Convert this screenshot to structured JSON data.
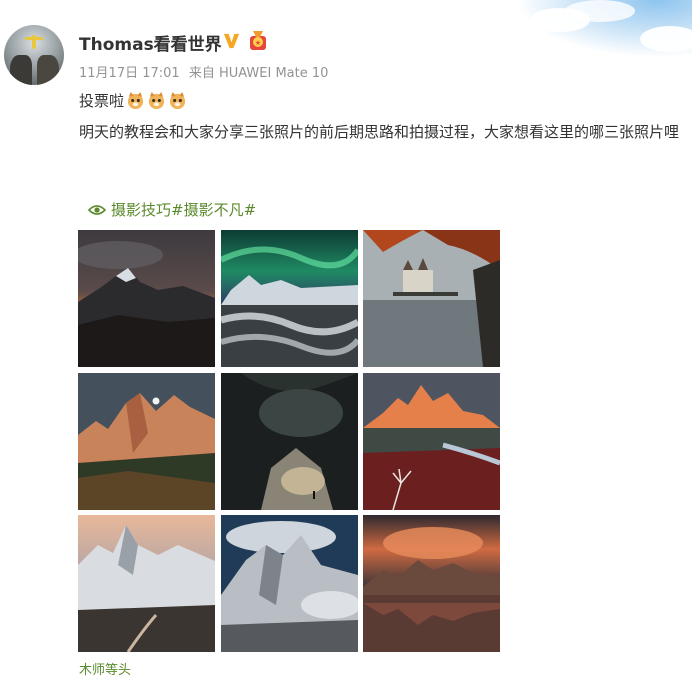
{
  "post": {
    "username": "Thomas看看世界",
    "verified_badge": "v-icon",
    "medal_badge": "medal-icon",
    "date": "11月17日 17:01",
    "source": "来自 HUAWEI Mate 10",
    "line1": "投票啦",
    "line1_emojis": [
      "cat-emoji",
      "cat-emoji",
      "cat-emoji"
    ],
    "body": "明天的教程会和大家分享三张照片的前后期思路和拍摄过程，大家想看这里的哪三张照片哩",
    "topics": "摄影技巧#摄影不凡#",
    "footer_hint": "木师等头"
  },
  "photos": [
    {
      "subject": "mountain-dusk"
    },
    {
      "subject": "aurora-stream"
    },
    {
      "subject": "castle-lake"
    },
    {
      "subject": "dolomites-moon"
    },
    {
      "subject": "cave-light"
    },
    {
      "subject": "fitzroy-sunrise"
    },
    {
      "subject": "snow-peaks"
    },
    {
      "subject": "cloudy-summit"
    },
    {
      "subject": "torres-reflection"
    }
  ],
  "colors": {
    "text": "#333333",
    "meta": "#939393",
    "topic": "#5a8a2c",
    "vip": "#f5a623"
  }
}
